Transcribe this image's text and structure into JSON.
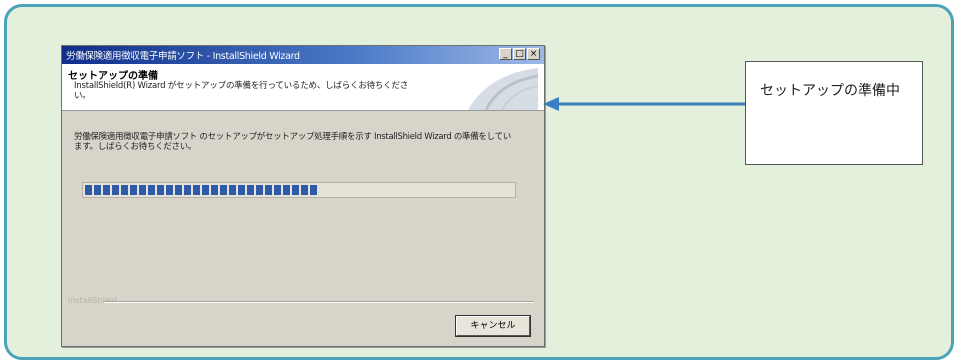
{
  "window": {
    "title": "労働保険適用徴収電子申請ソフト - InstallShield Wizard",
    "controls": [
      "_",
      "□",
      "×"
    ]
  },
  "header": {
    "title": "セットアップの準備",
    "description": "InstallShield(R) Wizard がセットアップの準備を行っているため、しばらくお待ちください。"
  },
  "body": {
    "message": "労働保険適用徴収電子申請ソフト のセットアップがセットアップ処理手順を示す InstallShield Wizard の準備をしています。しばらくお待ちください。"
  },
  "progress": {
    "fraction": 0.57,
    "segments": 26
  },
  "footer": {
    "brand": "InstallShield",
    "cancel_label": "キャンセル"
  },
  "callout": {
    "text": "セットアップの準備中"
  },
  "colors": {
    "frame_border": "#4aa3b8",
    "frame_bg": "#e3f0dc",
    "progress_fill": "#2f5aa8",
    "arrow": "#3b7fc0"
  }
}
